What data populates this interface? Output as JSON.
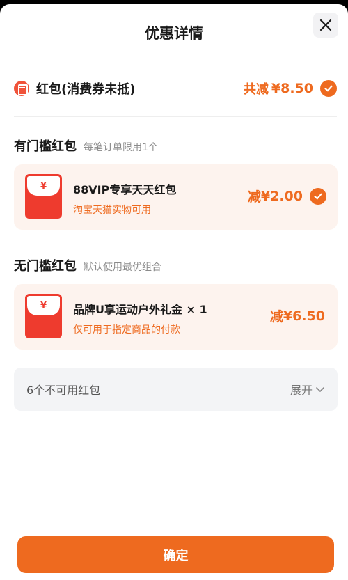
{
  "header": {
    "title": "优惠详情",
    "close_icon": "close-icon"
  },
  "summary": {
    "label": "红包(消费券未抵)",
    "total_label": "共减",
    "total_amount": "¥8.50",
    "icon": "red-packet-icon"
  },
  "sections": [
    {
      "name": "有门槛红包",
      "note": "每笔订单限用1个",
      "card": {
        "title": "88VIP专享天天红包",
        "desc": "淘宝天猫实物可用",
        "amount_label": "减",
        "amount": "¥2.00",
        "checked": true,
        "yen_mark": "¥"
      }
    },
    {
      "name": "无门槛红包",
      "note": "默认使用最优组合",
      "card": {
        "title": "品牌U享运动户外礼金 × 1",
        "desc": "仅可用于指定商品的付款",
        "amount_label": "减",
        "amount": "¥6.50",
        "checked": false,
        "yen_mark": "¥"
      }
    }
  ],
  "unavailable": {
    "label": "6个不可用红包",
    "expand_label": "展开"
  },
  "footer": {
    "confirm_label": "确定"
  },
  "colors": {
    "accent": "#ee6a1f",
    "card_bg": "#fdf3ee",
    "envelope": "#ee3b2e"
  }
}
